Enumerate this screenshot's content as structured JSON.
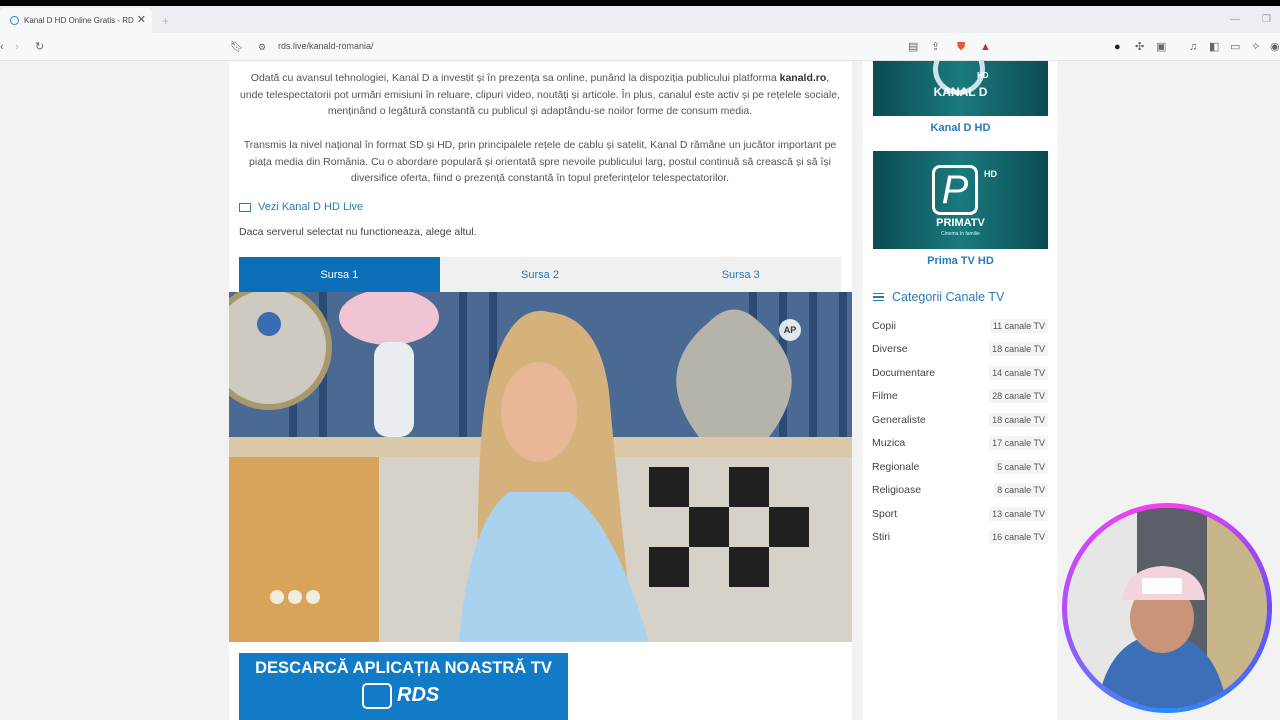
{
  "browser": {
    "tab_title": "Kanal D HD Online Gratis - RD",
    "url": "rds.live/kanald-romania/"
  },
  "article": {
    "p1_before": "Odată cu avansul tehnologiei, Kanal D a investit și în prezența sa online, punând la dispoziția publicului platforma ",
    "p1_bold": "kanald.ro",
    "p1_after": ", unde telespectatorii pot urmări emisiuni în reluare, clipuri video, noutăți și articole. În plus, canalul este activ și pe rețelele sociale, menținând o legătură constantă cu publicul și adaptându-se noilor forme de consum media.",
    "p2": "Transmis la nivel național în format SD și HD, prin principalele rețele de cablu și satelit, Kanal D rămâne un jucător important pe piața media din România. Cu o abordare populară și orientată spre nevoile publicului larg, postul continuă să crească și să își diversifice oferta, fiind o prezență constantă în topul preferințelor telespectatorilor.",
    "live_link": "Vezi Kanal D HD Live",
    "note": "Daca serverul selectat nu functioneaza, alege altul."
  },
  "sources": [
    "Sursa 1",
    "Sursa 2",
    "Sursa 3"
  ],
  "player": {
    "badge": "AP"
  },
  "promo": {
    "title": "DESCARCĂ APLICAȚIA NOASTRĂ TV",
    "logo": "RDS"
  },
  "sidebar": {
    "channels": [
      {
        "name": "Kanal D HD",
        "logo": "KANAL D",
        "hd": "HD"
      },
      {
        "name": "Prima TV HD",
        "logo": "PRIMATV",
        "hd": "HD",
        "tagline": "Cinema în familie"
      }
    ],
    "categories_title": "Categorii Canale TV",
    "categories": [
      {
        "name": "Copii",
        "count": "11 canale TV"
      },
      {
        "name": "Diverse",
        "count": "18 canale TV"
      },
      {
        "name": "Documentare",
        "count": "14 canale TV"
      },
      {
        "name": "Filme",
        "count": "28 canale TV"
      },
      {
        "name": "Generaliste",
        "count": "18 canale TV"
      },
      {
        "name": "Muzica",
        "count": "17 canale TV"
      },
      {
        "name": "Regionale",
        "count": "5 canale TV"
      },
      {
        "name": "Religioase",
        "count": "8 canale TV"
      },
      {
        "name": "Sport",
        "count": "13 canale TV"
      },
      {
        "name": "Stiri",
        "count": "16 canale TV"
      }
    ]
  },
  "colors": {
    "accent": "#2a7ab8",
    "active_tab": "#0d6eb8",
    "promo_bg": "#127bc8",
    "channel_bg": "#0e5a63"
  }
}
